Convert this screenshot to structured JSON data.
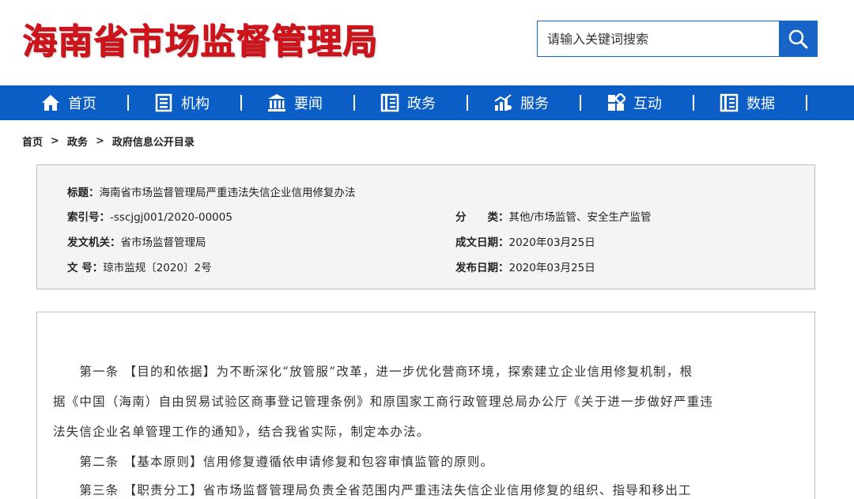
{
  "header": {
    "logo_text": "海南省市场监督管理局",
    "search": {
      "placeholder": "请输入关键词搜索"
    }
  },
  "nav": {
    "items": [
      {
        "label": "首页",
        "icon": "home-icon"
      },
      {
        "label": "机构",
        "icon": "building-list-icon"
      },
      {
        "label": "要闻",
        "icon": "bank-icon"
      },
      {
        "label": "政务",
        "icon": "book-icon"
      },
      {
        "label": "服务",
        "icon": "bar-chart-icon"
      },
      {
        "label": "互动",
        "icon": "grid-icon"
      },
      {
        "label": "数据",
        "icon": "book-icon"
      }
    ]
  },
  "breadcrumb": {
    "home": "首页",
    "level1": "政务",
    "current": "政府信息公开目录",
    "sep": ">"
  },
  "meta": {
    "title_key": "标题：",
    "title_val": "海南省市场监督管理局严重违法失信企业信用修复办法",
    "index_key": "索引号：",
    "index_val": "-sscjgj001/2020-00005",
    "category_key": "分　　类：",
    "category_val": "其他/市场监管、安全生产监管",
    "issuer_key": "发文机关：",
    "issuer_val": "省市场监督管理局",
    "date_written_key": "成文日期：",
    "date_written_val": "2020年03月25日",
    "doc_no_key": "文 号：",
    "doc_no_val": "琼市监规〔2020〕2号",
    "date_published_key": "发布日期：",
    "date_published_val": "2020年03月25日"
  },
  "content": {
    "para1_line1": "　　第一条 【目的和依据】为不断深化“放管服”改革，进一步优化营商环境，探索建立企业信用修复机制，根",
    "para1_line2": "据《中国（海南）自由贸易试验区商事登记管理条例》和原国家工商行政管理总局办公厅《关于进一步做好严重违",
    "para1_line3": "法失信企业名单管理工作的通知》，结合我省实际，制定本办法。",
    "para2": "　　第二条 【基本原则】信用修复遵循依申请修复和包容审慎监管的原则。",
    "para3": "　　第三条 【职责分工】省市场监督管理局负责全省范围内严重违法失信企业信用修复的组织、指导和移出工"
  },
  "colors": {
    "brand_red": "#d0141b",
    "nav_blue": "#0c5ec7",
    "meta_bg": "#f4f4f4"
  }
}
